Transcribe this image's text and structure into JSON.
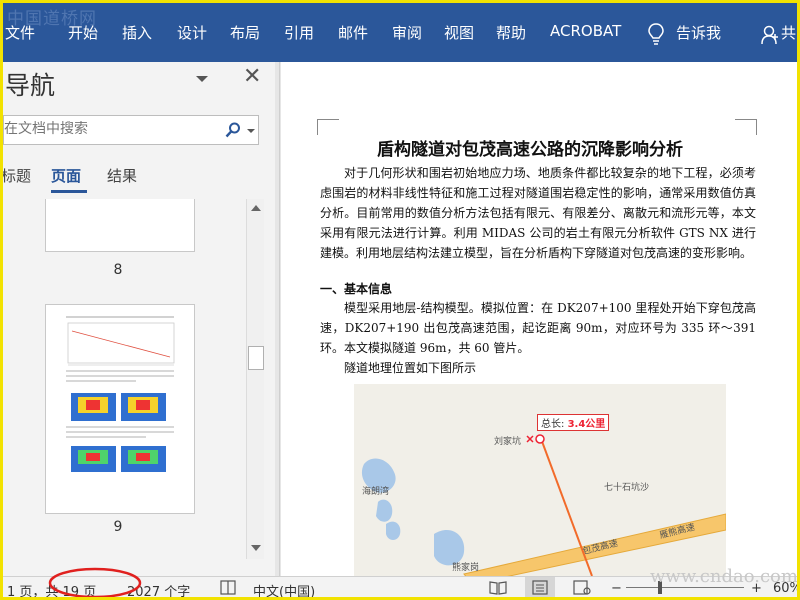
{
  "ribbon": {
    "watermark": "中国道桥网",
    "tabs": [
      "文件",
      "开始",
      "插入",
      "设计",
      "布局",
      "引用",
      "邮件",
      "审阅",
      "视图",
      "帮助",
      "ACROBAT",
      "告诉我",
      "共"
    ]
  },
  "nav": {
    "title": "导航",
    "search_placeholder": "在文档中搜索",
    "tabs": [
      "标题",
      "页面",
      "结果"
    ],
    "active_tab": "页面",
    "pages": [
      "8",
      "9"
    ]
  },
  "doc": {
    "title": "盾构隧道对包茂高速公路的沉降影响分析",
    "para1": "对于几何形状和围岩初始地应力场、地质条件都比较复杂的地下工程，必须考虑围岩的材料非线性特征和施工过程对隧道围岩稳定性的影响，通常采用数值仿真分析。目前常用的数值分析方法包括有限元、有限差分、离散元和流形元等，本文采用有限元法进行计算。利用 MIDAS 公司的岩土有限元分析软件 GTS NX 进行建模。利用地层结构法建立模型，旨在分析盾构下穿隧道对包茂高速的变形影响。",
    "heading": "一、基本信息",
    "para2": "模型采用地层-结构模型。模拟位置：在 DK207+100 里程处开始下穿包茂高速，DK207+190 出包茂高速范围，起讫距离 90m，对应环号为 335 环～391 环。本文模拟隧道 96m，共 60 管片。",
    "para3": "隧道地理位置如下图所示",
    "map": {
      "scale_label": "总长:",
      "scale_value": "3.4公里",
      "places": [
        "刘家坑",
        "七十石坑沙",
        "海朗湾",
        "包茂高速",
        "雁熊高速",
        "熊家岗"
      ]
    }
  },
  "status": {
    "page_info": "1 页，共 19 页",
    "word_count": "2027 个字",
    "language": "中文(中国)",
    "zoom": "60%",
    "zoom_minus": "−",
    "zoom_plus": "+"
  },
  "corner_watermark": "www.cndao.com",
  "colors": {
    "ribbon": "#2b579a",
    "frame": "#f2e200",
    "annotation": "#e0201e",
    "squiggle": "#2a54c8"
  }
}
